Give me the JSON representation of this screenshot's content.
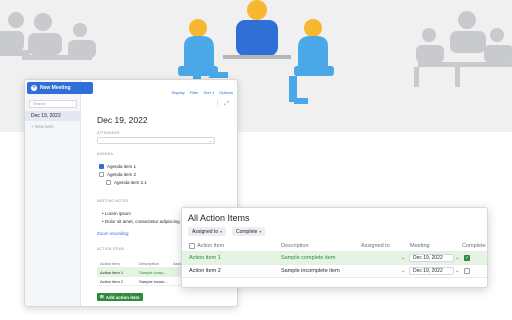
{
  "meeting_window": {
    "new_meeting_label": "New Meeting",
    "search_placeholder": "Search",
    "sidebar_items": [
      "Dec 19, 2022"
    ],
    "new_item_label": "+ New item",
    "top_menu": [
      "Display",
      "Filter",
      "Sort 1",
      "Options"
    ],
    "meeting_title": "Dec 19, 2022",
    "attendees_label": "ATTENDEES",
    "agenda_label": "AGENDA",
    "agenda_items": [
      {
        "label": "Agenda item 1",
        "checked": true
      },
      {
        "label": "Agenda item 2",
        "checked": false
      },
      {
        "label": "Agenda item 2.1",
        "checked": false
      }
    ],
    "notes_label": "MEETING NOTES",
    "notes": [
      "Lorem ipsum",
      "Dolor sit amet, consectetur adipiscing el..."
    ],
    "zoom_link": "Zoom recording",
    "action_items_label": "ACTION ITEMS",
    "mini_table": {
      "headers": [
        "Action item",
        "Description",
        "Assig"
      ],
      "rows": [
        {
          "item": "Action item 1",
          "desc": "Sample comp...",
          "assignee": ""
        },
        {
          "item": "Action item 2",
          "desc": "Sample incom...",
          "assignee": ""
        }
      ]
    },
    "add_button_label": "Add action item"
  },
  "action_items_window": {
    "title": "All Action Items",
    "filters": [
      "Assigned to",
      "Complete"
    ],
    "columns": [
      "Action item",
      "Description",
      "Assigned to",
      "Meeting",
      "Complete"
    ],
    "rows": [
      {
        "item": "Action item 1",
        "description": "Sample complete item",
        "assigned_to": "",
        "meeting": "Dec 19, 2022",
        "complete": true
      },
      {
        "item": "Action item 2",
        "description": "Sample incomplete item",
        "assigned_to": "",
        "meeting": "Dec 19, 2022",
        "complete": false
      }
    ]
  },
  "colors": {
    "accent": "#2f6fd6",
    "success": "#2e8b3d",
    "person_head": "#f7b731",
    "person_body": "#4aa8e8",
    "silhouette": "#c9cacd"
  }
}
